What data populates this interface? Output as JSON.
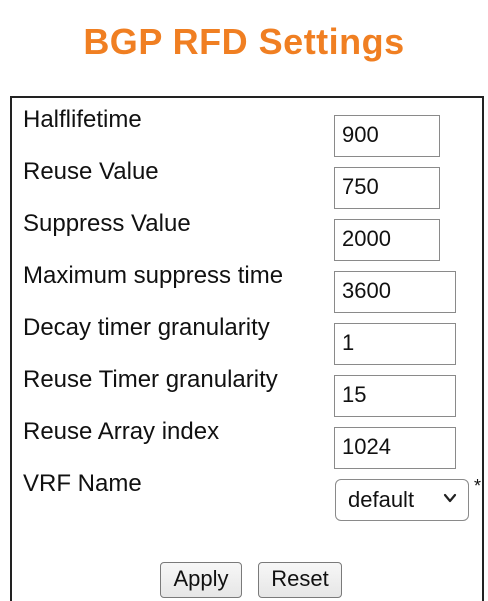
{
  "title": "BGP RFD Settings",
  "accent_color": "#f07f22",
  "fields": [
    {
      "label": "Halflifetime",
      "value": "900"
    },
    {
      "label": "Reuse Value",
      "value": "750"
    },
    {
      "label": "Suppress Value",
      "value": "2000"
    },
    {
      "label": "Maximum suppress time",
      "value": "3600"
    },
    {
      "label": "Decay timer granularity",
      "value": "1"
    },
    {
      "label": "Reuse Timer granularity",
      "value": "15"
    },
    {
      "label": "Reuse Array index",
      "value": "1024"
    }
  ],
  "vrf": {
    "label": "VRF Name",
    "selected": "default",
    "required_mark": "*"
  },
  "buttons": {
    "apply": "Apply",
    "reset": "Reset"
  }
}
